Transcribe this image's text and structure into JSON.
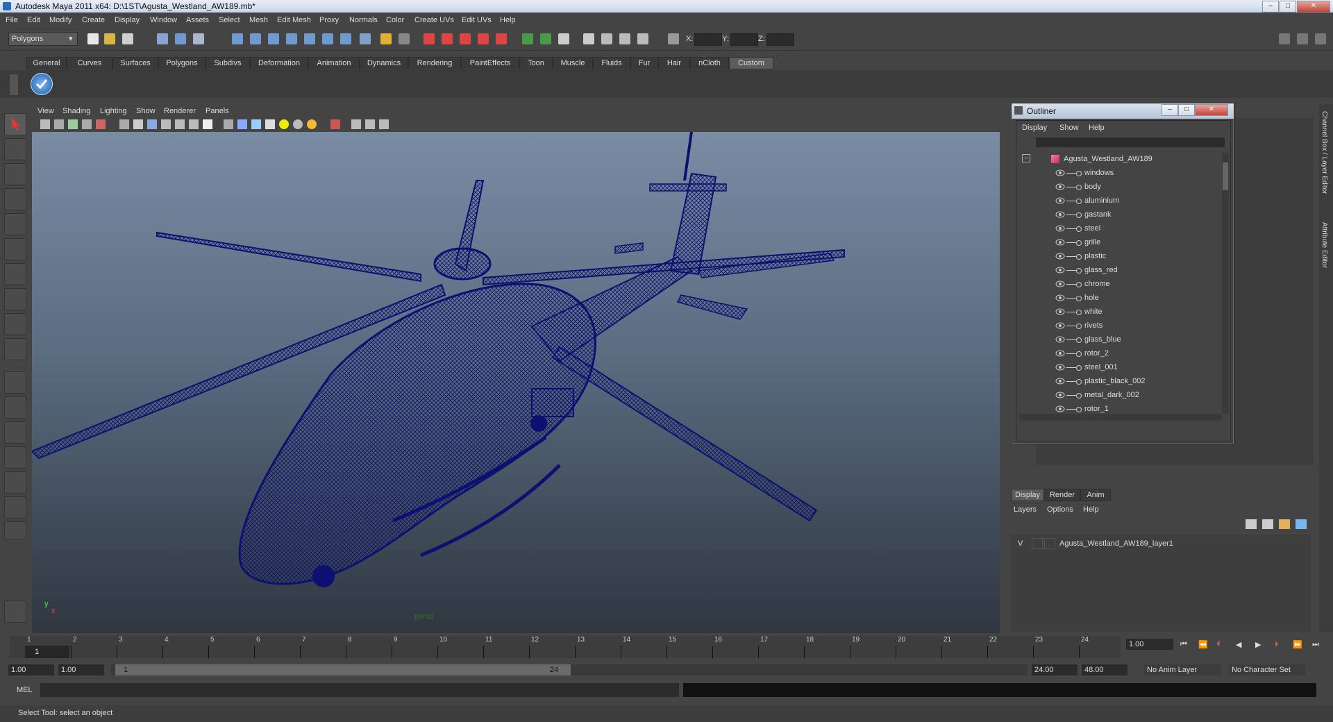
{
  "window": {
    "title": "Autodesk Maya 2011 x64: D:\\1ST\\Agusta_Westland_AW189.mb*",
    "controls": {
      "minimize": "–",
      "maximize": "□",
      "close": "✕"
    }
  },
  "menubar": [
    "File",
    "Edit",
    "Modify",
    "Create",
    "Display",
    "Window",
    "Assets",
    "Select",
    "Mesh",
    "Edit Mesh",
    "Proxy",
    "Normals",
    "Color",
    "Create UVs",
    "Edit UVs",
    "Help"
  ],
  "toolbar": {
    "mode_select": "Polygons",
    "xyz_labels": [
      "X:",
      "Y:",
      "Z:"
    ]
  },
  "shelf": {
    "tabs": [
      "General",
      "Curves",
      "Surfaces",
      "Polygons",
      "Subdivs",
      "Deformation",
      "Animation",
      "Dynamics",
      "Rendering",
      "PaintEffects",
      "Toon",
      "Muscle",
      "Fluids",
      "Fur",
      "Hair",
      "nCloth",
      "Custom"
    ],
    "active": "Custom"
  },
  "viewport": {
    "menu": [
      "View",
      "Shading",
      "Lighting",
      "Show",
      "Renderer",
      "Panels"
    ],
    "camera_label": "persp",
    "axis": {
      "x": "x",
      "y": "y"
    },
    "wire_color": "#0d1070"
  },
  "outliner": {
    "title": "Outliner",
    "menu": [
      "Display",
      "Show",
      "Help"
    ],
    "root": "Agusta_Westland_AW189",
    "expander": "–",
    "children": [
      "windows",
      "body",
      "aluminium",
      "gastank",
      "steel",
      "grille",
      "plastic",
      "glass_red",
      "chrome",
      "hole",
      "white",
      "rivets",
      "glass_blue",
      "rotor_2",
      "steel_001",
      "plastic_black_002",
      "metal_dark_002",
      "rotor_1"
    ]
  },
  "side_strip": {
    "channel_box": "Channel Box / Layer Editor",
    "attribute_editor": "Attribute Editor"
  },
  "layer_editor": {
    "tabs": [
      "Display",
      "Render",
      "Anim"
    ],
    "active_tab": "Display",
    "menu": [
      "Layers",
      "Options",
      "Help"
    ],
    "layers": [
      {
        "visibility": "V",
        "name": "Agusta_Westland_AW189_layer1"
      }
    ]
  },
  "time_slider": {
    "ticks": [
      "1",
      "2",
      "3",
      "4",
      "5",
      "6",
      "7",
      "8",
      "9",
      "10",
      "11",
      "12",
      "13",
      "14",
      "15",
      "16",
      "17",
      "18",
      "19",
      "20",
      "21",
      "22",
      "23",
      "24"
    ],
    "current_frame_marker": "1",
    "current_time": "1.00"
  },
  "range_slider": {
    "start_time": "1.00",
    "playback_start": "1.00",
    "range_start_label": "1",
    "range_end_label": "24",
    "playback_end": "24.00",
    "end_time": "48.00",
    "anim_layer": "No Anim Layer",
    "character_set": "No Character Set"
  },
  "command_line": {
    "label": "MEL"
  },
  "help_line": "Select Tool: select an object"
}
